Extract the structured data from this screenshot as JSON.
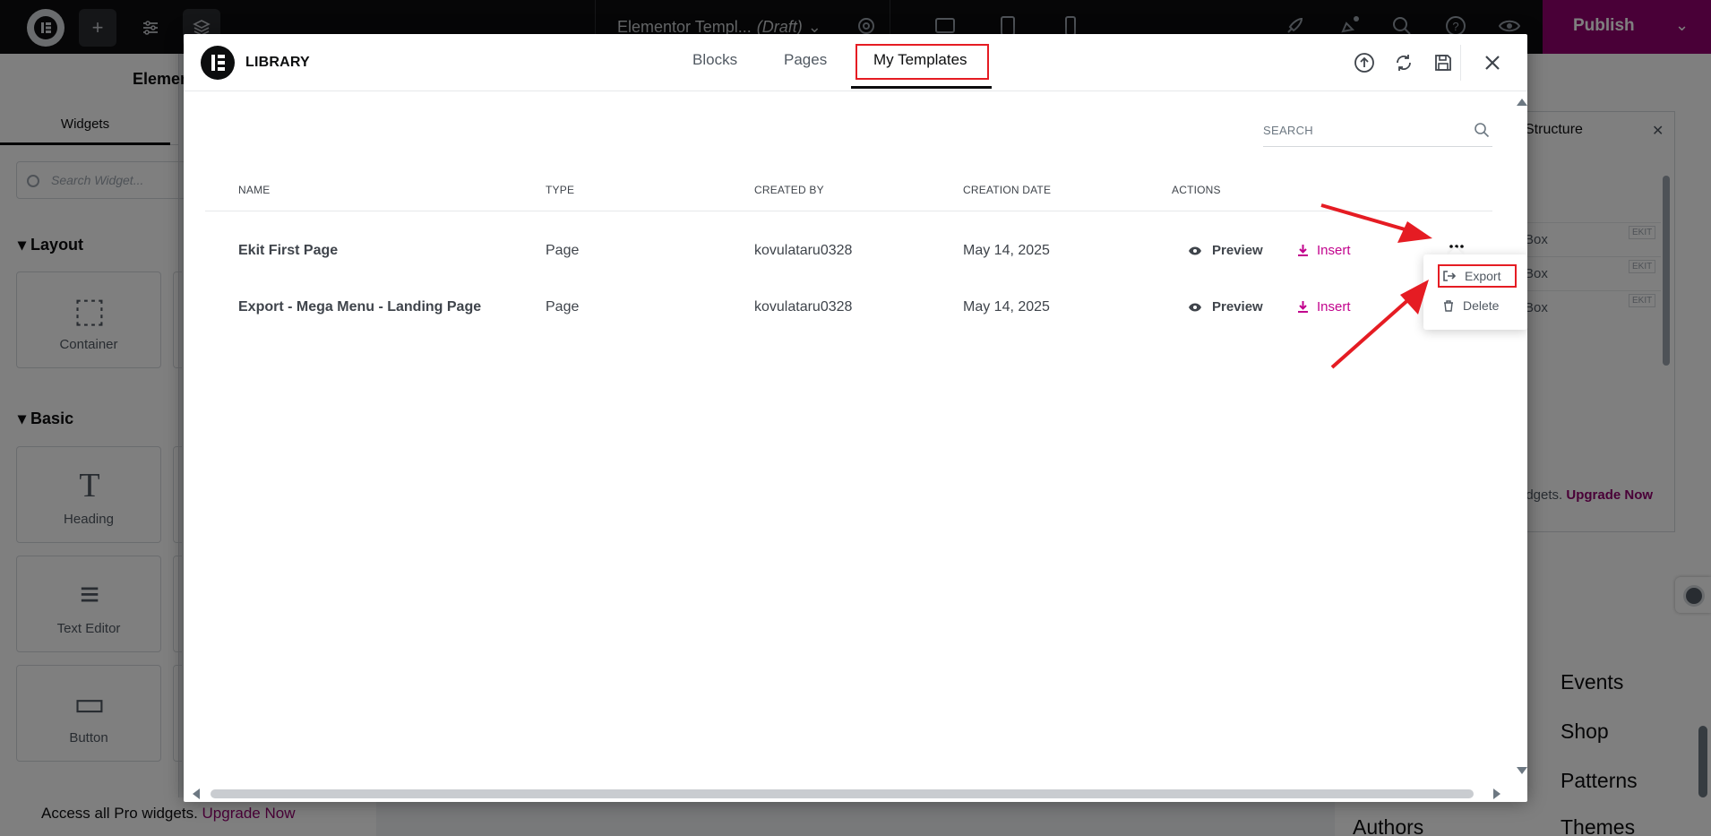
{
  "editor": {
    "doc_title": "Elementor Templ...",
    "doc_status": "(Draft)",
    "publish_label": "Publish",
    "panel_title": "Elemen",
    "panel_tab": "Widgets",
    "search_placeholder": "Search Widget...",
    "sections": {
      "layout": "Layout",
      "basic": "Basic"
    },
    "widgets": [
      "Container",
      "Heading",
      "Text Editor",
      "Button"
    ],
    "promo_text": "Access all Pro widgets.",
    "promo_link": "Upgrade Now"
  },
  "structure": {
    "title": "Structure",
    "rows": [
      "Box",
      "Box",
      "Box"
    ],
    "badge": "EKIT",
    "footer_text": "idgets.",
    "footer_link": "Upgrade Now"
  },
  "site_nav": [
    "Events",
    "Shop",
    "Patterns",
    "Themes",
    "Authors"
  ],
  "library": {
    "title": "LIBRARY",
    "tabs": [
      "Blocks",
      "Pages",
      "My Templates"
    ],
    "active_tab": "My Templates",
    "search_placeholder": "SEARCH",
    "columns": [
      "NAME",
      "TYPE",
      "CREATED BY",
      "CREATION DATE",
      "ACTIONS"
    ],
    "rows": [
      {
        "name": "Ekit First Page",
        "type": "Page",
        "created_by": "kovulataru0328",
        "date": "May 14, 2025",
        "preview": "Preview",
        "insert": "Insert"
      },
      {
        "name": "Export - Mega Menu - Landing Page",
        "type": "Page",
        "created_by": "kovulataru0328",
        "date": "May 14, 2025",
        "preview": "Preview",
        "insert": "Insert"
      }
    ],
    "menu": {
      "export": "Export",
      "delete": "Delete"
    }
  },
  "colors": {
    "accent": "#c2038d",
    "brand": "#93006f",
    "annotation": "#e51c23"
  }
}
